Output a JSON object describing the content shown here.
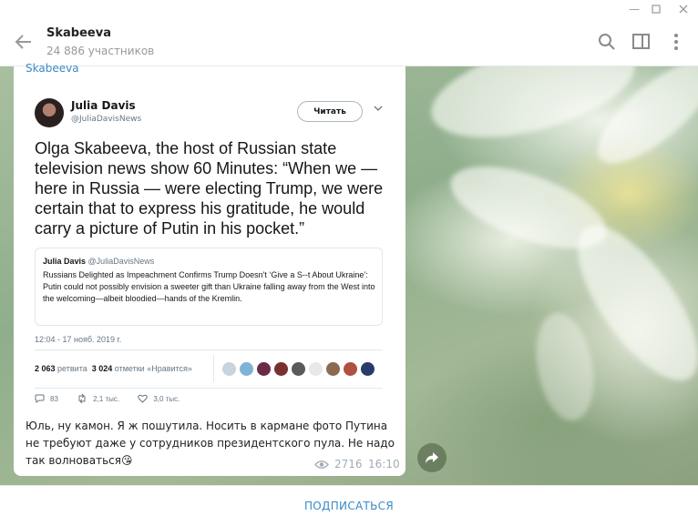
{
  "header": {
    "title": "Skabeeva",
    "subtitle": "24 886 участников"
  },
  "message": {
    "sender": "Skabeeva",
    "tweet": {
      "author": "Julia Davis",
      "handle": "@JuliaDavisNews",
      "follow_label": "Читать",
      "text": "Olga Skabeeva, the host of Russian state television news show 60 Minutes: “When we — here in Russia — were electing Trump, we were certain that to express his gratitude, he would carry a picture of Putin in his pocket.”",
      "quote": {
        "author": "Julia Davis",
        "handle": "@JuliaDavisNews",
        "text": "Russians Delighted as Impeachment Confirms Trump Doesn't ‘Give a S--t About Ukraine’: Putin could not possibly envision a sweeter gift than Ukraine falling away from the West into the welcoming—albeit bloodied—hands of the Kremlin."
      },
      "timestamp": "12:04 - 17 нояб. 2019 г.",
      "retweets_count": "2 063",
      "retweets_label": "ретвита",
      "likes_count": "3 024",
      "likes_label": "отметки «Нравится»",
      "reply_count": "83",
      "retweet_action_count": "2,1 тыс.",
      "like_action_count": "3,0 тыс."
    },
    "caption": "Юль, ну камон. Я ж пошутила. Носить в кармане фото Путина не требуют даже у сотрудников президентского пула. Не надо так волноваться😘",
    "views": "2716",
    "time": "16:10"
  },
  "footer": {
    "subscribe_label": "ПОДПИСАТЬСЯ"
  },
  "colors": {
    "accent": "#3a8ac6",
    "muted": "#a0acb6"
  }
}
